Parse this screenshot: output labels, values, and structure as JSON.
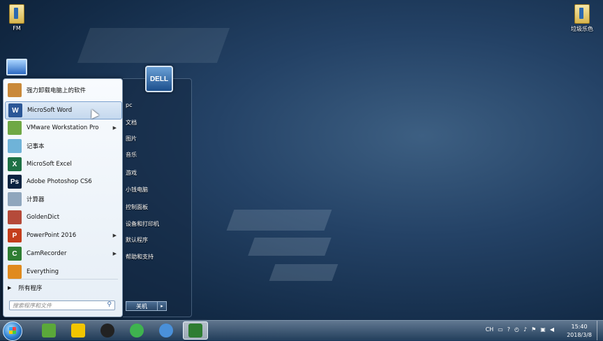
{
  "desktop": {
    "icons": [
      {
        "label": "FM",
        "icon": "folder-icon"
      },
      {
        "label": "垃圾乐色",
        "icon": "folder-icon"
      },
      {
        "label": "",
        "icon": "computer-icon"
      }
    ]
  },
  "start_menu": {
    "programs": [
      {
        "label": "强力卸载电脑上的软件",
        "icon": "uninstaller-icon",
        "color": "#c9893a",
        "glyph": "",
        "arrow": false
      },
      {
        "label": "MicroSoft Word",
        "icon": "word-icon",
        "color": "#2b5797",
        "glyph": "W",
        "arrow": false,
        "highlighted": true
      },
      {
        "label": "VMware Workstation Pro",
        "icon": "vmware-icon",
        "color": "#6fa845",
        "glyph": "",
        "arrow": true
      },
      {
        "label": "记事本",
        "icon": "notepad-icon",
        "color": "#6fb3d8",
        "glyph": "",
        "arrow": false
      },
      {
        "label": "MicroSoft Excel",
        "icon": "excel-icon",
        "color": "#1e7145",
        "glyph": "X",
        "arrow": false
      },
      {
        "label": "Adobe Photoshop CS6",
        "icon": "photoshop-icon",
        "color": "#0a2340",
        "glyph": "Ps",
        "arrow": false
      },
      {
        "label": "计算器",
        "icon": "calculator-icon",
        "color": "#8fa6bd",
        "glyph": "",
        "arrow": false
      },
      {
        "label": "GoldenDict",
        "icon": "goldendict-icon",
        "color": "#b54a3a",
        "glyph": "",
        "arrow": false
      },
      {
        "label": "PowerPoint 2016",
        "icon": "powerpoint-icon",
        "color": "#c43e1c",
        "glyph": "P",
        "arrow": true
      },
      {
        "label": "CamRecorder",
        "icon": "camrecorder-icon",
        "color": "#2e7d32",
        "glyph": "C",
        "arrow": true
      },
      {
        "label": "Everything",
        "icon": "everything-icon",
        "color": "#e08a1e",
        "glyph": "",
        "arrow": false
      }
    ],
    "all_programs": "所有程序",
    "search_placeholder": "搜索程序和文件",
    "right_items": [
      "pc",
      "文档",
      "图片",
      "音乐",
      "游戏",
      "小钱电脑",
      "控制面板",
      "设备和打印机",
      "默认程序",
      "帮助和支持"
    ],
    "logo_text": "DELL",
    "shutdown_label": "关机"
  },
  "taskbar": {
    "pinned": [
      {
        "icon": "game-icon",
        "color": "#5ba83a"
      },
      {
        "icon": "player-icon",
        "color": "#f2c500"
      },
      {
        "icon": "camera-icon",
        "color": "#222222"
      },
      {
        "icon": "sync-icon",
        "color": "#3fb34f"
      },
      {
        "icon": "globe-icon",
        "color": "#4a90d9"
      },
      {
        "icon": "camrecorder-icon",
        "color": "#2e7d32",
        "active": true
      }
    ],
    "tray_lang": "CH",
    "time": "15:40",
    "date": "2018/3/8"
  }
}
